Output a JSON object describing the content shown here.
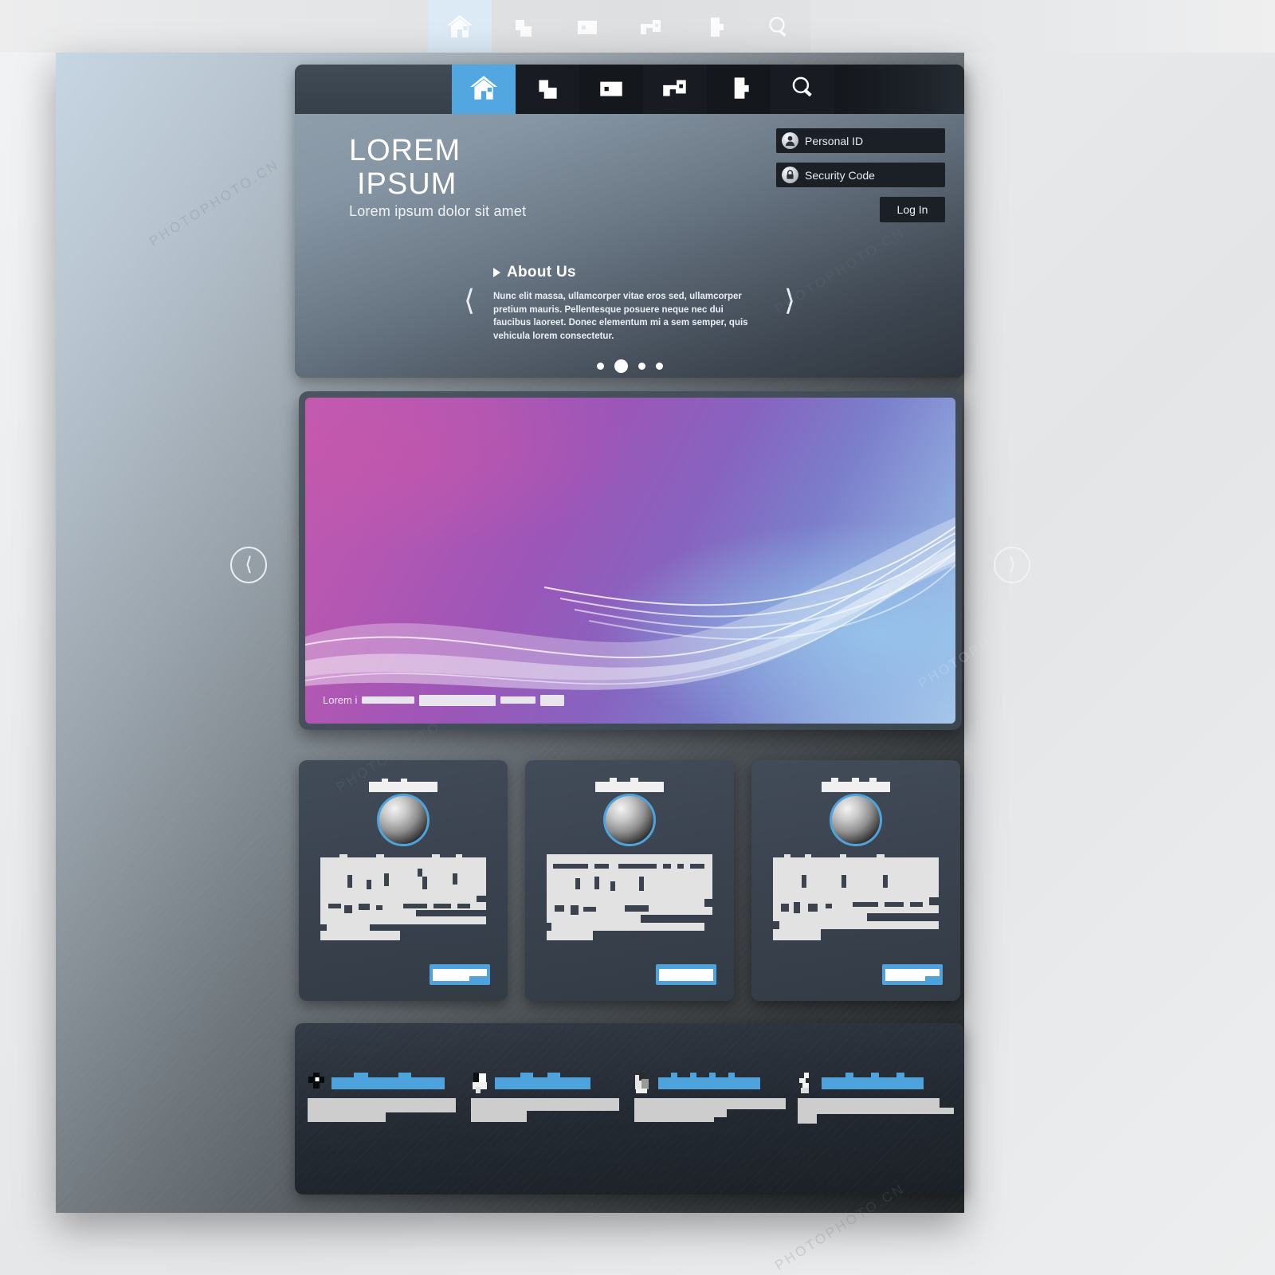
{
  "nav": {
    "items": [
      {
        "id": "home",
        "icon": "home-icon",
        "active": true
      },
      {
        "id": "pages",
        "icon": "stepped-blocks-icon",
        "active": false
      },
      {
        "id": "media",
        "icon": "rectangle-dot-icon",
        "active": false
      },
      {
        "id": "services",
        "icon": "arrow-block-icon",
        "active": false
      },
      {
        "id": "contact",
        "icon": "blob-icon",
        "active": false
      },
      {
        "id": "search",
        "icon": "magnifier-icon",
        "active": false
      }
    ]
  },
  "brand": {
    "line1": "LOREM",
    "line2": "IPSUM",
    "tagline": "Lorem ipsum dolor sit amet"
  },
  "login": {
    "personal_id_placeholder": "Personal ID",
    "personal_id_value": "",
    "personal_id_icon": "user-avatar-icon",
    "security_code_placeholder": "Security Code",
    "security_code_value": "",
    "security_code_icon": "padlock-icon",
    "login_button": "Log In"
  },
  "about": {
    "title": "About Us",
    "body": "Nunc elit massa, ullamcorper vitae eros sed, ullamcorper pretium mauris. Pellentesque posuere neque nec dui faucibus laoreet. Donec elementum mi a sem semper, quis vehicula lorem consectetur.",
    "prev_icon": "chevron-left-icon",
    "next_icon": "chevron-right-icon",
    "dots": 4,
    "active_dot": 1
  },
  "hero": {
    "caption": "Lorem i",
    "prev_icon": "circle-chevron-left-icon",
    "next_icon": "circle-chevron-right-icon",
    "colors": {
      "pink": "#c45bb0",
      "purple": "#8763bf",
      "blue": "#a9c6ea"
    }
  },
  "cards": [
    {
      "title_redacted": true,
      "avatar": "person-avatar-icon",
      "body_redacted": true,
      "button_redacted": true
    },
    {
      "title_redacted": true,
      "avatar": "person-avatar-icon",
      "body_redacted": true,
      "button_redacted": true
    },
    {
      "title_redacted": true,
      "avatar": "person-avatar-icon",
      "body_redacted": true,
      "button_redacted": true
    }
  ],
  "footer": {
    "columns": [
      {
        "icon": "dark-badge-icon",
        "heading_redacted": true,
        "body_redacted": true
      },
      {
        "icon": "dark-light-badge-icon",
        "heading_redacted": true,
        "body_redacted": true
      },
      {
        "icon": "gray-badge-icon",
        "heading_redacted": true,
        "body_redacted": true
      },
      {
        "icon": "light-badge-icon",
        "heading_redacted": true,
        "body_redacted": true
      }
    ]
  },
  "theme": {
    "accent": "#4fa3dd",
    "dark": "#1b2027",
    "header_gradient_top": "#8e9eab"
  },
  "watermarks": [
    "PHOTOPHOTO.CN",
    "PHOTOPHOTO.CN",
    "PHOTOPHOTO.CN",
    "PHOTOPHOTO.CN",
    "PHOTOPHOTO.CN",
    "PHOTOPHOTO.CN"
  ]
}
